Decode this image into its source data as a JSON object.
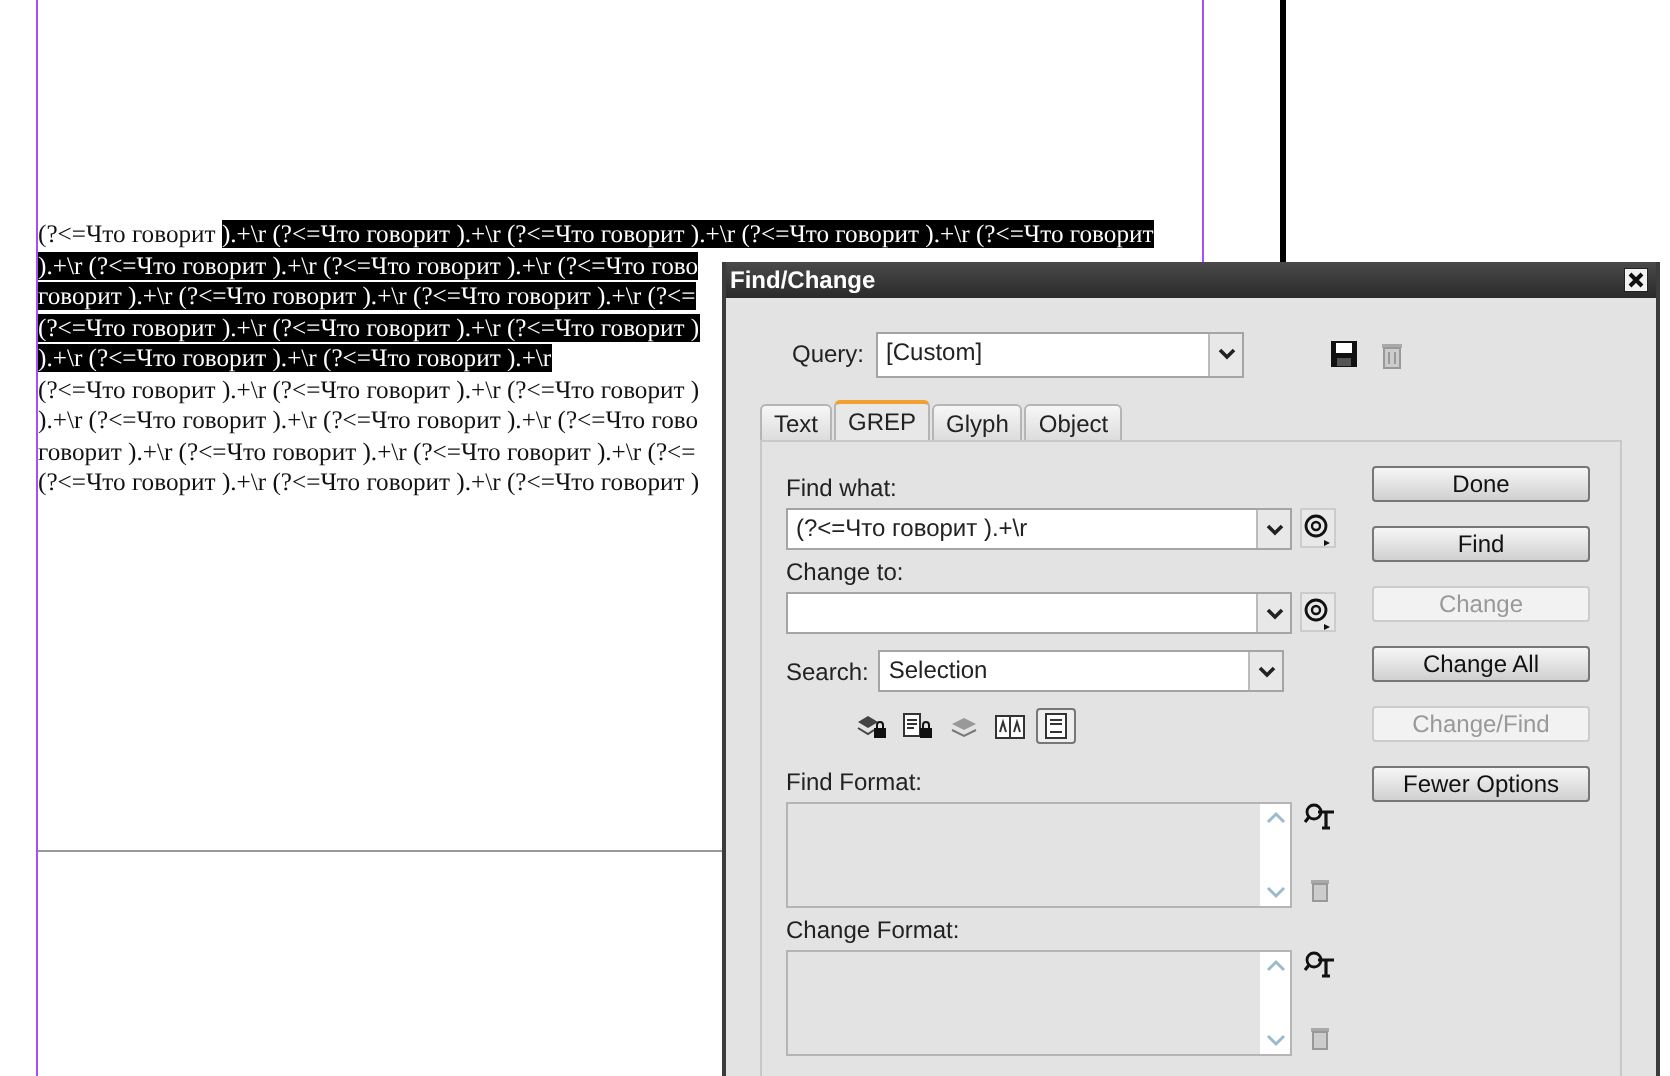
{
  "document": {
    "lines": [
      {
        "segments": [
          {
            "text": "(?<=Что говорит ",
            "selected": false
          },
          {
            "text": ").+\\r (?<=Что говорит ).+\\r (?<=Что говорит ).+\\r (?<=Что говорит ).+\\r (?<=Что говорит",
            "selected": true
          }
        ]
      },
      {
        "segments": [
          {
            "text": ").+\\r (?<=Что говорит ).+\\r (?<=Что говорит ).+\\r (?<=Что гово",
            "selected": true
          }
        ]
      },
      {
        "segments": [
          {
            "text": "говорит ).+\\r (?<=Что говорит ).+\\r (?<=Что говорит ).+\\r (?<=",
            "selected": true
          }
        ]
      },
      {
        "segments": [
          {
            "text": "(?<=Что говорит ).+\\r (?<=Что говорит ).+\\r (?<=Что говорит )",
            "selected": true
          }
        ]
      },
      {
        "segments": [
          {
            "text": ").+\\r (?<=Что говорит ).+\\r (?<=Что говорит ).+\\r",
            "selected": true
          }
        ]
      },
      {
        "segments": [
          {
            "text": "(?<=Что говорит ).+\\r (?<=Что говорит ).+\\r (?<=Что говорит )",
            "selected": false
          }
        ]
      },
      {
        "segments": [
          {
            "text": ").+\\r (?<=Что говорит ).+\\r (?<=Что говорит ).+\\r (?<=Что гово",
            "selected": false
          }
        ]
      },
      {
        "segments": [
          {
            "text": "говорит ).+\\r (?<=Что говорит ).+\\r (?<=Что говорит ).+\\r (?<=",
            "selected": false
          }
        ]
      },
      {
        "segments": [
          {
            "text": "(?<=Что говорит ).+\\r (?<=Что говорит ).+\\r (?<=Что говорит )",
            "selected": false
          }
        ]
      }
    ]
  },
  "dialog": {
    "title": "Find/Change",
    "query": {
      "label": "Query:",
      "value": "[Custom]"
    },
    "tabs": [
      {
        "label": "Text",
        "selected": false
      },
      {
        "label": "GREP",
        "selected": true
      },
      {
        "label": "Glyph",
        "selected": false
      },
      {
        "label": "Object",
        "selected": false
      }
    ],
    "find_what": {
      "label": "Find what:",
      "value": "(?<=Что говорит ).+\\r"
    },
    "change_to": {
      "label": "Change to:"
    },
    "search": {
      "label": "Search:",
      "value": "Selection"
    },
    "options": [
      {
        "kind": "locked-layers",
        "on": false
      },
      {
        "kind": "locked-stories",
        "on": false
      },
      {
        "kind": "hidden-layers",
        "on": false
      },
      {
        "kind": "master-pages",
        "on": false
      },
      {
        "kind": "footnotes",
        "on": true
      }
    ],
    "find_format": {
      "label": "Find Format:"
    },
    "change_format": {
      "label": "Change Format:"
    },
    "buttons": [
      {
        "label": "Done",
        "disabled": false
      },
      {
        "label": "Find",
        "disabled": false
      },
      {
        "label": "Change",
        "disabled": true
      },
      {
        "label": "Change All",
        "disabled": false
      },
      {
        "label": "Change/Find",
        "disabled": true
      },
      {
        "label": "Fewer Options",
        "disabled": false
      }
    ]
  }
}
